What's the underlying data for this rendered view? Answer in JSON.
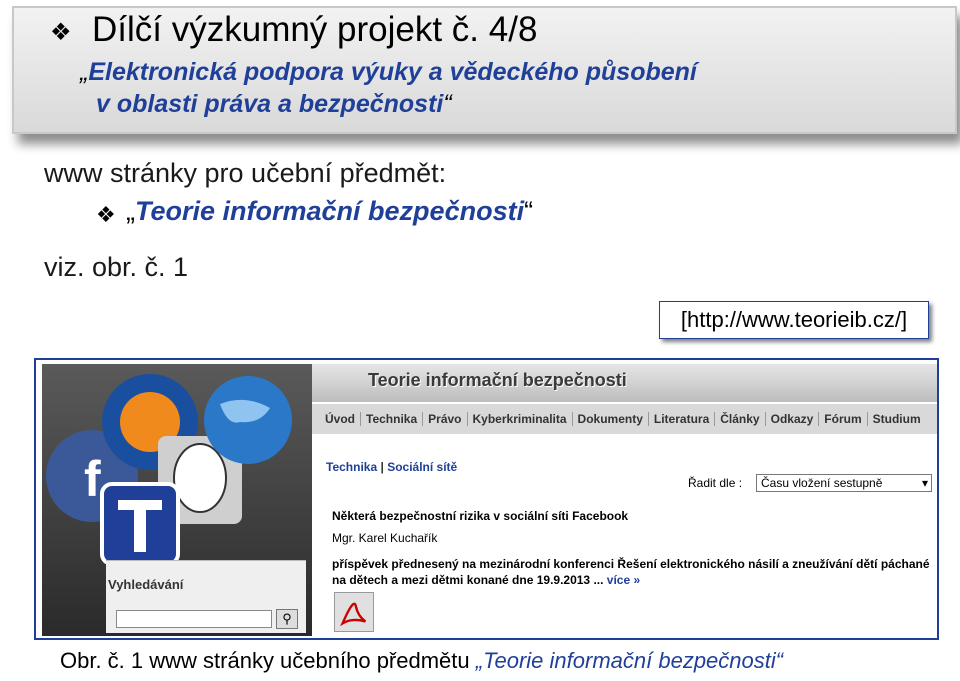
{
  "header": {
    "title": "Dílčí výzkumný projekt č. 4/8",
    "subtitle_open_quote": "„",
    "subtitle_line1": "Elektronická podpora výuky a vědeckého působení",
    "subtitle_line2": "v oblasti práva a bezpečnosti",
    "subtitle_close_quote": "“"
  },
  "body": {
    "intro": "www stránky pro učební předmět:",
    "bullet_open_quote": "„",
    "bullet_text": "Teorie informační bezpečnosti",
    "bullet_close_quote": "“",
    "viz": "viz. obr. č. 1"
  },
  "url_label": "[http://www.teorieib.cz/]",
  "screenshot": {
    "site_title": "Teorie informační bezpečnosti",
    "nav": [
      "Úvod",
      "Technika",
      "Právo",
      "Kyberkriminalita",
      "Dokumenty",
      "Literatura",
      "Články",
      "Odkazy",
      "Fórum",
      "Studium"
    ],
    "breadcrumb_1": "Technika",
    "breadcrumb_sep": "|",
    "breadcrumb_2": "Sociální sítě",
    "sort_label": "Řadit dle :",
    "sort_value": "Času vložení sestupně",
    "article_title": "Některá bezpečnostní rizika v sociální síti Facebook",
    "article_author": "Mgr. Karel Kuchařík",
    "article_text": "příspěvek přednesený na mezinárodní konferenci Řešení elektronického násilí a zneužívání dětí páchané na dětech a mezi dětmi konané dne 19.9.2013 ...",
    "article_more": "více »",
    "search_label": "Vyhledávání",
    "search_button_icon": "magnifier-icon",
    "pdf_icon": "pdf-icon"
  },
  "caption": {
    "prefix": "Obr. č. 1 www stránky učebního předmětu ",
    "open_quote": "„",
    "italic": "Teorie informační bezpečnosti",
    "close_quote": "“"
  },
  "colors": {
    "accent": "#1f3f99",
    "header_bg": "#e6e6e6"
  }
}
